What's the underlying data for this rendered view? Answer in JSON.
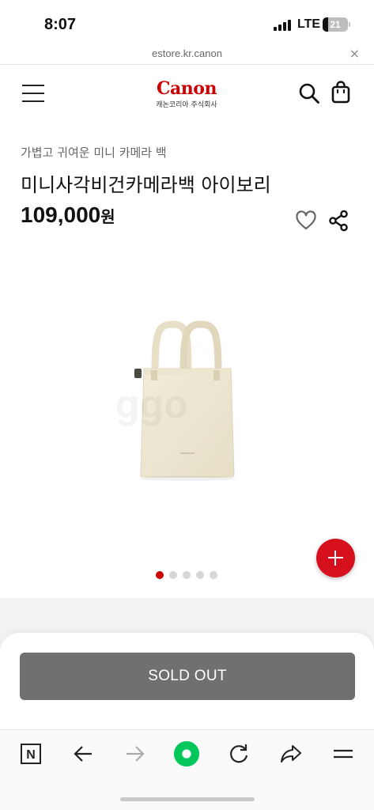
{
  "status_bar": {
    "time": "8:07",
    "network": "LTE",
    "battery": "21",
    "battery_level": 0.21
  },
  "browser": {
    "url": "estore.kr.canon",
    "close_label": "×"
  },
  "header": {
    "logo_text": "Canon",
    "logo_sub": "캐논코리아 주식회사"
  },
  "product": {
    "subtitle": "가볍고 귀여운 미니 카메라 백",
    "title": "미니사각비건카메라백 아이보리",
    "price": "109,000",
    "price_unit": "원",
    "image_alt": "ivory mini vegan camera tote bag",
    "watermark": "ggo",
    "carousel": {
      "total": 5,
      "active_index": 0
    }
  },
  "actions": {
    "sold_out_label": "SOLD OUT"
  },
  "colors": {
    "brand_red": "#cc0000",
    "fab_red": "#d7101e",
    "sold_out_gray": "#707070",
    "naver_green": "#03c75a"
  },
  "toolbar": {
    "items": [
      "n-icon",
      "back-arrow-icon",
      "forward-arrow-icon",
      "green-dot-icon",
      "refresh-icon",
      "share-arrow-icon",
      "menu-icon"
    ],
    "n_label": "N"
  }
}
